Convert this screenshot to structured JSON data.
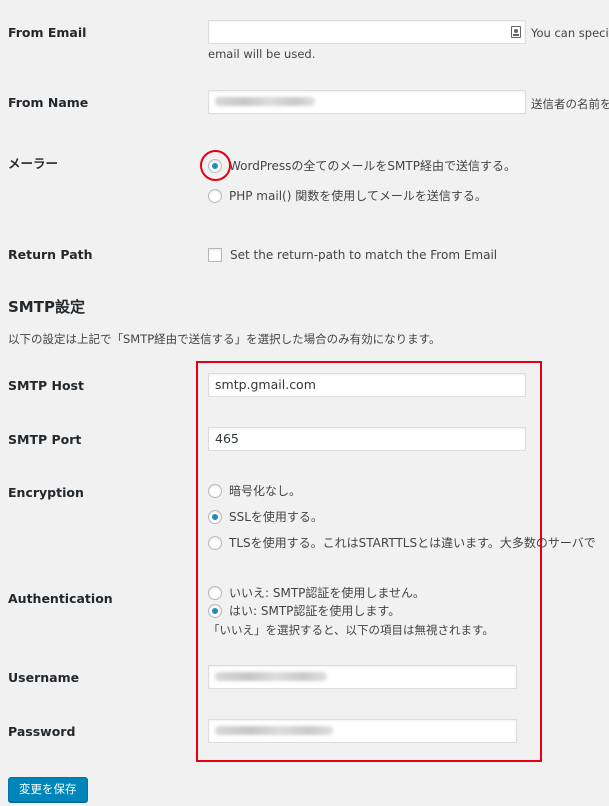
{
  "from_email": {
    "label": "From Email",
    "value": "",
    "desc_right": "You can specif",
    "desc_below": "email will be used."
  },
  "from_name": {
    "label": "From Name",
    "desc_right": "送信者の名前を"
  },
  "mailer": {
    "label": "メーラー",
    "options": [
      {
        "label": "WordPressの全てのメールをSMTP経由で送信する。",
        "checked": true
      },
      {
        "label": "PHP mail() 関数を使用してメールを送信する。",
        "checked": false
      }
    ]
  },
  "return_path": {
    "label": "Return Path",
    "checkbox_label": "Set the return-path to match the From Email",
    "checked": false
  },
  "smtp_section": {
    "title": "SMTP設定",
    "description": "以下の設定は上記で「SMTP経由で送信する」を選択した場合のみ有効になります。"
  },
  "smtp_host": {
    "label": "SMTP Host",
    "value": "smtp.gmail.com"
  },
  "smtp_port": {
    "label": "SMTP Port",
    "value": "465"
  },
  "encryption": {
    "label": "Encryption",
    "options": [
      {
        "label": "暗号化なし。",
        "checked": false
      },
      {
        "label": "SSLを使用する。",
        "checked": true
      },
      {
        "label": "TLSを使用する。これはSTARTTLSとは違います。大多数のサーバで",
        "checked": false
      }
    ]
  },
  "authentication": {
    "label": "Authentication",
    "options": [
      {
        "label": "いいえ: SMTP認証を使用しません。",
        "checked": false
      },
      {
        "label": "はい: SMTP認証を使用します。",
        "checked": true
      }
    ],
    "note": "「いいえ」を選択すると、以下の項目は無視されます。"
  },
  "username": {
    "label": "Username"
  },
  "password": {
    "label": "Password"
  },
  "save_button": {
    "label": "変更を保存"
  },
  "colors": {
    "background": "#f1f1f1",
    "accent": "#0085ba",
    "radio_checked": "#1e8cbe",
    "highlight": "#e60012"
  }
}
